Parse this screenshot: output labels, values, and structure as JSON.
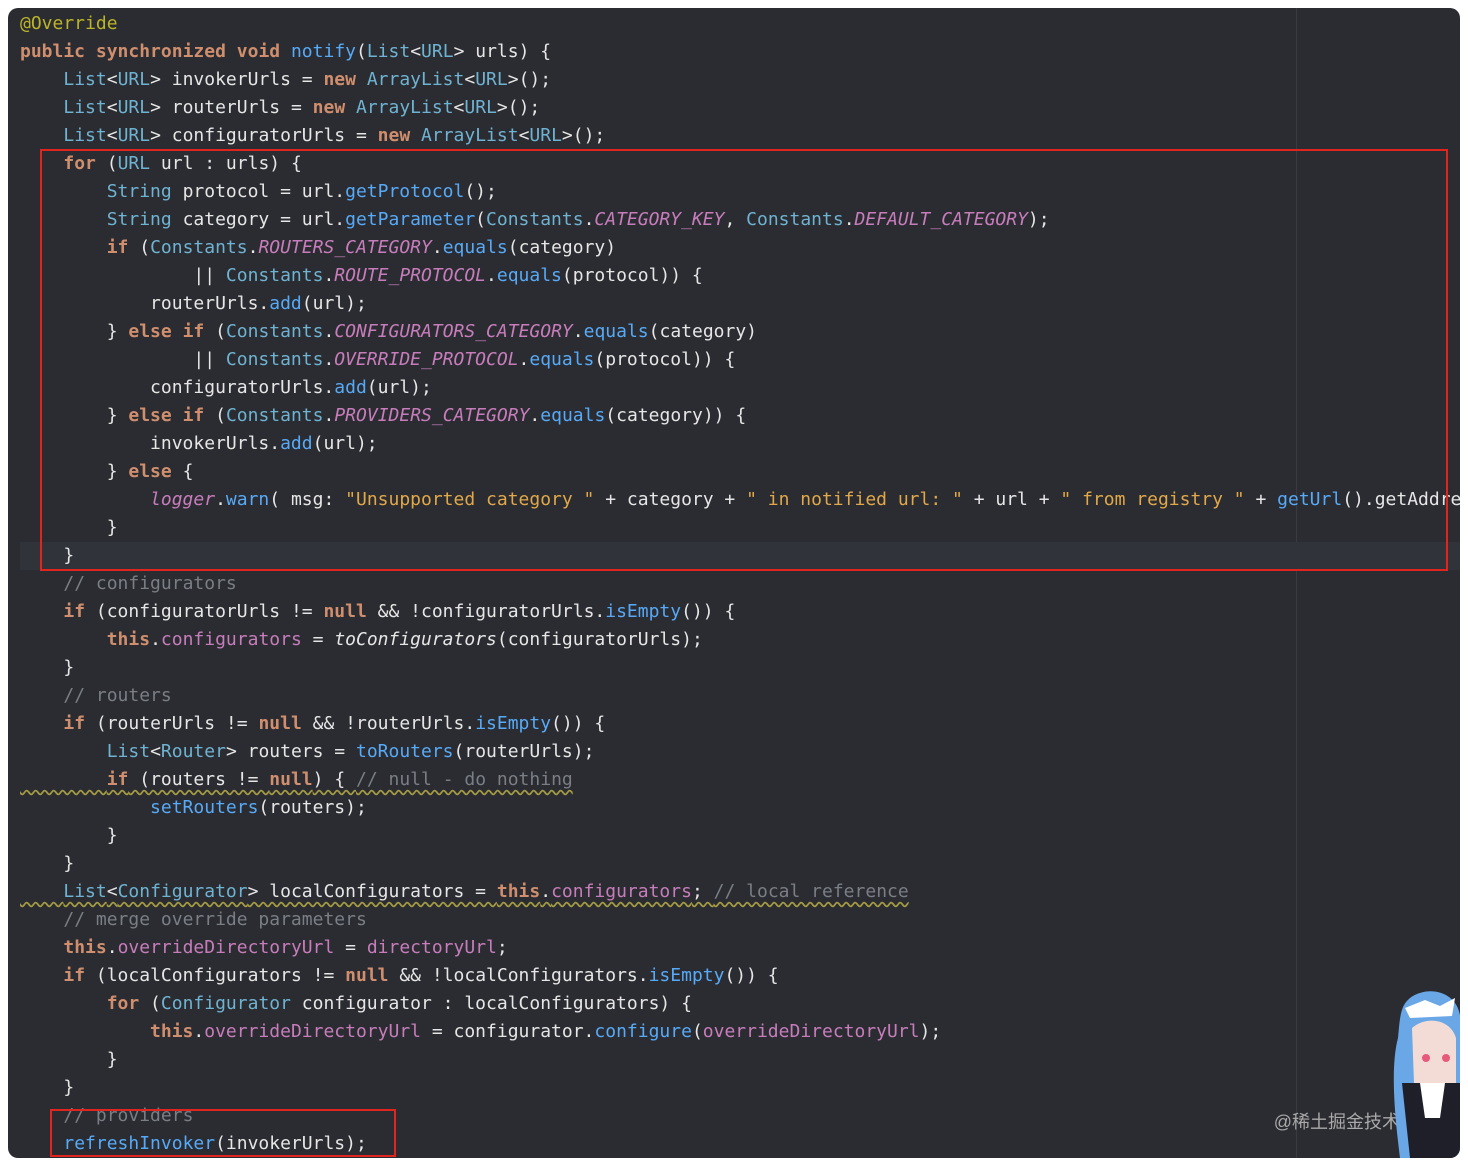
{
  "code_lines": [
    "@Override",
    "public synchronized void notify(List<URL> urls) {",
    "    List<URL> invokerUrls = new ArrayList<URL>();",
    "    List<URL> routerUrls = new ArrayList<URL>();",
    "    List<URL> configuratorUrls = new ArrayList<URL>();",
    "    for (URL url : urls) {",
    "        String protocol = url.getProtocol();",
    "        String category = url.getParameter(Constants.CATEGORY_KEY, Constants.DEFAULT_CATEGORY);",
    "        if (Constants.ROUTERS_CATEGORY.equals(category)",
    "                || Constants.ROUTE_PROTOCOL.equals(protocol)) {",
    "            routerUrls.add(url);",
    "        } else if (Constants.CONFIGURATORS_CATEGORY.equals(category)",
    "                || Constants.OVERRIDE_PROTOCOL.equals(protocol)) {",
    "            configuratorUrls.add(url);",
    "        } else if (Constants.PROVIDERS_CATEGORY.equals(category)) {",
    "            invokerUrls.add(url);",
    "        } else {",
    "            logger.warn( msg: \"Unsupported category \" + category + \" in notified url: \" + url + \" from registry \" + getUrl().getAddre",
    "        }",
    "    }",
    "    // configurators",
    "    if (configuratorUrls != null && !configuratorUrls.isEmpty()) {",
    "        this.configurators = toConfigurators(configuratorUrls);",
    "    }",
    "    // routers",
    "    if (routerUrls != null && !routerUrls.isEmpty()) {",
    "        List<Router> routers = toRouters(routerUrls);",
    "        if (routers != null) { // null - do nothing",
    "            setRouters(routers);",
    "        }",
    "    }",
    "    List<Configurator> localConfigurators = this.configurators; // local reference",
    "    // merge override parameters",
    "    this.overrideDirectoryUrl = directoryUrl;",
    "    if (localConfigurators != null && !localConfigurators.isEmpty()) {",
    "        for (Configurator configurator : localConfigurators) {",
    "            this.overrideDirectoryUrl = configurator.configure(overrideDirectoryUrl);",
    "        }",
    "    }",
    "    // providers",
    "    refreshInvoker(invokerUrls);"
  ],
  "param_hint": "msg:",
  "watermark": "@稀土掘金技术社区",
  "colors": {
    "editor_bg": "#2b2c31",
    "keyword": "#cf8e6d",
    "type": "#6fb3d2",
    "string": "#e1a84a",
    "comment": "#7a7e85",
    "annotation": "#bbb529",
    "constant": "#c77dbb",
    "highlight_box": "#e0241e"
  }
}
